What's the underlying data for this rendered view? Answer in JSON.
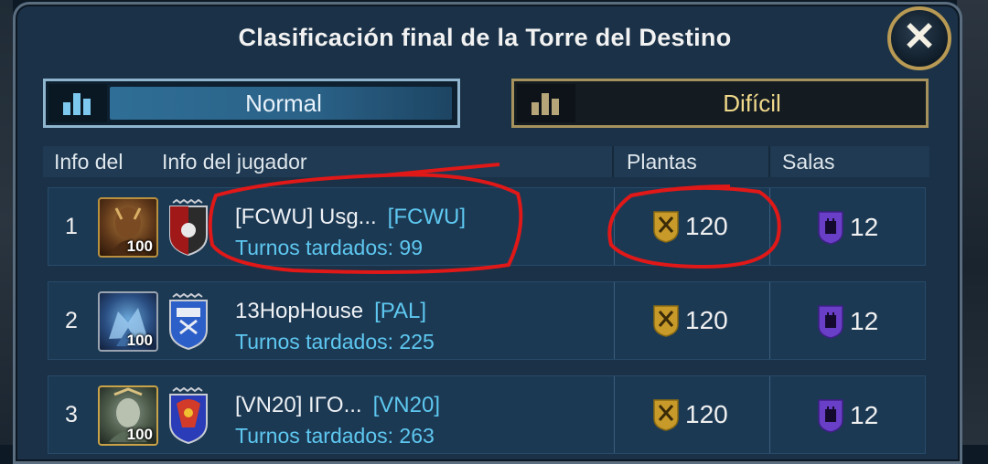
{
  "window": {
    "title": "Clasificación final de la Torre del Destino",
    "close_label": "✕"
  },
  "tabs": [
    {
      "label": "Normal",
      "active": true
    },
    {
      "label": "Difícil",
      "active": false
    }
  ],
  "table": {
    "columns": [
      "Info del",
      "Info del jugador",
      "Plantas",
      "Salas"
    ],
    "rows": [
      {
        "rank": "1",
        "level": "100",
        "name": "[FCWU] Usg...",
        "clan": "[FCWU]",
        "turns": "Turnos tardados: 99",
        "floors": "120",
        "rooms": "12"
      },
      {
        "rank": "2",
        "level": "100",
        "name": "13HopHouse",
        "clan": "[PAL]",
        "turns": "Turnos tardados: 225",
        "floors": "120",
        "rooms": "12"
      },
      {
        "rank": "3",
        "level": "100",
        "name": "[VN20] ΙΓΟ...",
        "clan": "[VN20]",
        "turns": "Turnos tardados: 263",
        "floors": "120",
        "rooms": "12"
      }
    ]
  },
  "colors": {
    "panel": "#1a3147",
    "accent_blue": "#5ec8f0",
    "gold": "#b89a54",
    "annotation_red": "#e01818"
  }
}
